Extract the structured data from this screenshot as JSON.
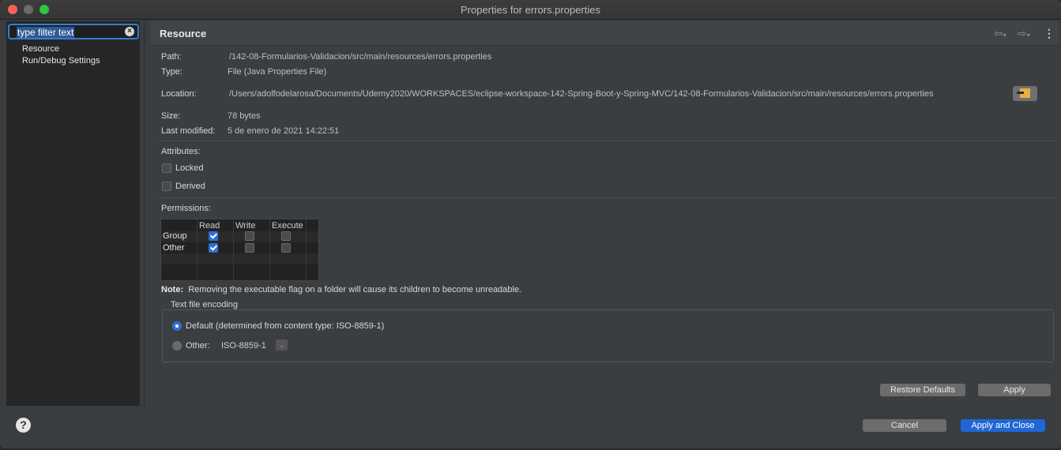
{
  "window": {
    "title": "Properties for errors.properties"
  },
  "filter": {
    "value": "type filter text"
  },
  "tree": {
    "items": [
      {
        "label": "Resource"
      },
      {
        "label": "Run/Debug Settings"
      }
    ]
  },
  "page": {
    "title": "Resource",
    "back_icon": "arrow-left-icon",
    "forward_icon": "arrow-right-icon",
    "menu_icon": "kebab-menu-icon"
  },
  "info": {
    "path_label": "Path:",
    "path_value": "/142-08-Formularios-Validacion/src/main/resources/errors.properties",
    "type_label": "Type:",
    "type_value": "File  (Java Properties File)",
    "location_label": "Location:",
    "location_value": "/Users/adolfodelarosa/Documents/Udemy2020/WORKSPACES/eclipse-workspace-142-Spring-Boot-y-Spring-MVC/142-08-Formularios-Validacion/src/main/resources/errors.properties",
    "size_label": "Size:",
    "size_value": "78  bytes",
    "modified_label": "Last modified:",
    "modified_value": "5 de enero de 2021 14:22:51"
  },
  "attributes": {
    "label": "Attributes:",
    "locked": {
      "label": "Locked",
      "checked": false
    },
    "derived": {
      "label": "Derived",
      "checked": false
    }
  },
  "permissions": {
    "label": "Permissions:",
    "columns": [
      "Read",
      "Write",
      "Execute"
    ],
    "rows": [
      {
        "label": "Group",
        "read": true,
        "write": false,
        "execute": false
      },
      {
        "label": "Other",
        "read": true,
        "write": false,
        "execute": false
      }
    ]
  },
  "note": {
    "prefix": "Note:",
    "text": "Removing the executable flag on a folder will cause its children to become unreadable."
  },
  "encoding": {
    "title": "Text file encoding",
    "default_label": "Default (determined from content type: ISO-8859-1)",
    "other_label": "Other:",
    "other_value": "ISO-8859-1",
    "selected": "default"
  },
  "buttons": {
    "restore": "Restore Defaults",
    "apply": "Apply",
    "cancel": "Cancel",
    "apply_close": "Apply and Close"
  },
  "help": {
    "glyph": "?"
  },
  "colors": {
    "accent": "#1f67d6",
    "close": "#fe5f57",
    "maximize": "#28c840"
  }
}
